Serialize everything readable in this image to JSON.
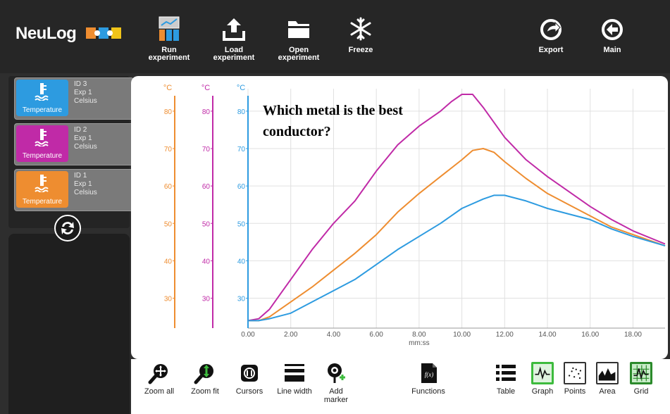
{
  "app": {
    "logo_text": "NeuLog"
  },
  "toolbar": {
    "run": "Run\nexperiment",
    "load": "Load\nexperiment",
    "open": "Open\nexperiment",
    "freeze": "Freeze",
    "export": "Export",
    "main": "Main"
  },
  "modules": [
    {
      "name": "Temperature",
      "id": "ID 3",
      "exp": "Exp 1",
      "unit": "Celsius",
      "color": "#2d9be0"
    },
    {
      "name": "Temperature",
      "id": "ID 2",
      "exp": "Exp 1",
      "unit": "Celsius",
      "color": "#c02aa7"
    },
    {
      "name": "Temperature",
      "id": "ID 1",
      "exp": "Exp 1",
      "unit": "Celsius",
      "color": "#ee8d30"
    }
  ],
  "annotation": {
    "question": "Which metal is the best conductor?"
  },
  "bottom_toolbar": {
    "zoom_all": "Zoom all",
    "zoom_fit": "Zoom fit",
    "cursors": "Cursors",
    "line_width": "Line width",
    "add_marker": "Add\nmarker",
    "functions": "Functions",
    "table": "Table",
    "graph": "Graph",
    "points": "Points",
    "area": "Area",
    "grid": "Grid",
    "functions_icon_text": "f(x)"
  },
  "chart_data": {
    "type": "line",
    "xlabel": "mm:ss",
    "x_ticks": [
      "0.00",
      "2.00",
      "4.00",
      "6.00",
      "8.00",
      "10.00",
      "12.00",
      "14.00",
      "16.00",
      "18.00"
    ],
    "xlim": [
      0,
      19.5
    ],
    "ylim": [
      22,
      86
    ],
    "y_ticks": [
      30,
      40,
      50,
      60,
      70,
      80
    ],
    "y_unit": "°C",
    "grid": true,
    "series": [
      {
        "color": "#c02aa7",
        "axis_color": "#c02aa7",
        "x": [
          0,
          0.5,
          1,
          1.5,
          2,
          2.5,
          3,
          3.5,
          4,
          5,
          6,
          7,
          8,
          9,
          9.5,
          10,
          10.5,
          11,
          11.5,
          12,
          13,
          14,
          15,
          16,
          17,
          18,
          19.5
        ],
        "y": [
          24,
          24.5,
          27,
          31,
          35,
          39,
          43,
          46.5,
          50,
          56,
          64,
          71,
          76,
          80,
          82.5,
          84.5,
          84.5,
          81,
          77,
          73,
          67,
          62.5,
          58.5,
          54.5,
          51,
          48,
          44.5
        ]
      },
      {
        "color": "#ee8d30",
        "axis_color": "#ee8d30",
        "x": [
          0,
          0.5,
          1,
          1.5,
          2,
          3,
          4,
          5,
          6,
          7,
          8,
          9,
          10,
          10.5,
          11,
          11.5,
          12,
          13,
          14,
          15,
          16,
          17,
          18,
          19.5
        ],
        "y": [
          24,
          24,
          25,
          27,
          29,
          33,
          37.5,
          42,
          47,
          53,
          58,
          62.5,
          67,
          69.5,
          70,
          69,
          66.5,
          62,
          58,
          55,
          52,
          49,
          47,
          44
        ]
      },
      {
        "color": "#2d9be0",
        "axis_color": "#2d9be0",
        "x": [
          0,
          0.5,
          1,
          2,
          3,
          4,
          5,
          6,
          7,
          8,
          9,
          10,
          11,
          11.5,
          12,
          13,
          14,
          15,
          16,
          17,
          18,
          19.5
        ],
        "y": [
          24,
          24,
          24.5,
          26,
          29,
          32,
          35,
          39,
          43,
          46.5,
          50,
          54,
          56.5,
          57.5,
          57.5,
          56,
          54,
          52.5,
          51,
          48.5,
          46.5,
          44
        ]
      }
    ]
  }
}
